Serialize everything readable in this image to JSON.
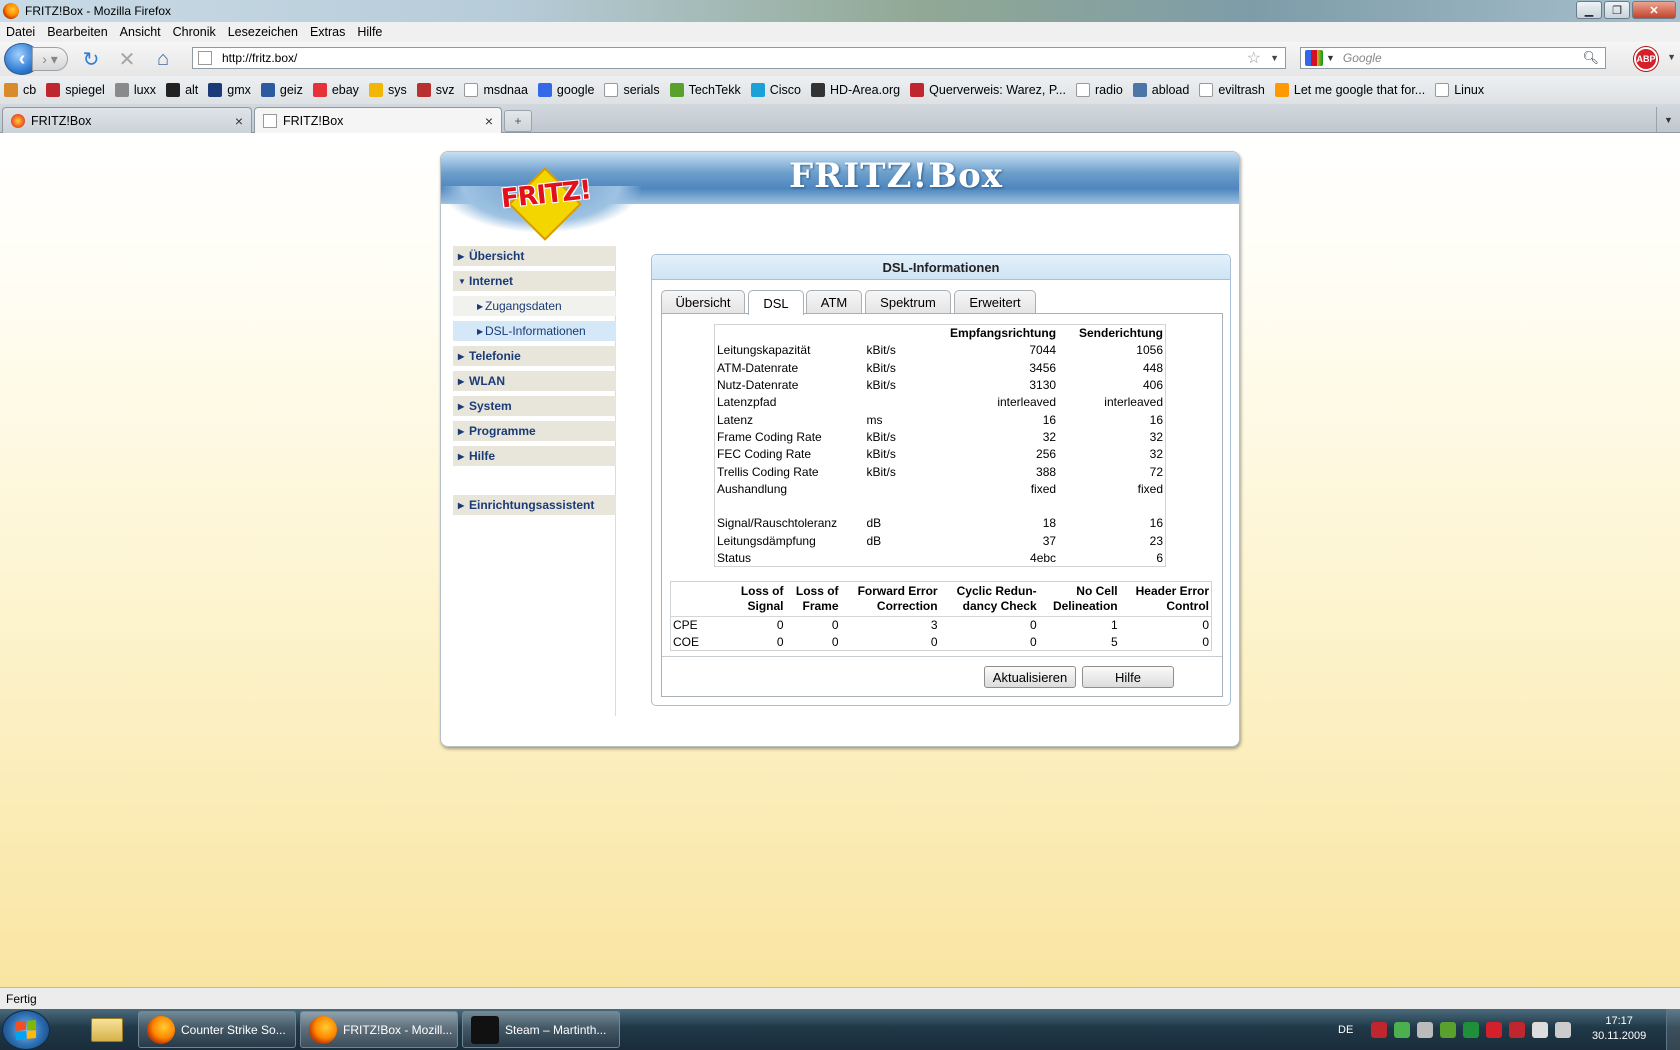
{
  "window": {
    "title": "FRITZ!Box - Mozilla Firefox"
  },
  "menu": [
    "Datei",
    "Bearbeiten",
    "Ansicht",
    "Chronik",
    "Lesezeichen",
    "Extras",
    "Hilfe"
  ],
  "navbar": {
    "url": "http://fritz.box/",
    "search_placeholder": "Google",
    "abp_label": "ABP"
  },
  "bookmarks": [
    {
      "label": "cb",
      "color": "#d98a2b"
    },
    {
      "label": "spiegel",
      "color": "#c0262d"
    },
    {
      "label": "luxx",
      "color": "#8a8a8a"
    },
    {
      "label": "alt",
      "color": "#222222"
    },
    {
      "label": "gmx",
      "color": "#1a3b78"
    },
    {
      "label": "geiz",
      "color": "#2c5aa0"
    },
    {
      "label": "ebay",
      "color": "#e53238"
    },
    {
      "label": "sys",
      "color": "#f2b705"
    },
    {
      "label": "svz",
      "color": "#b8312f"
    },
    {
      "label": "msdnaa",
      "color": "#ffffff"
    },
    {
      "label": "google",
      "color": "#3369e8"
    },
    {
      "label": "serials",
      "color": "#ffffff"
    },
    {
      "label": "TechTekk",
      "color": "#5aa02c"
    },
    {
      "label": "Cisco",
      "color": "#1ba0d7"
    },
    {
      "label": "HD-Area.org",
      "color": "#333333"
    },
    {
      "label": "Querverweis: Warez, P...",
      "color": "#c0262d"
    },
    {
      "label": "radio",
      "color": "#ffffff"
    },
    {
      "label": "abload",
      "color": "#4a76a8"
    },
    {
      "label": "eviltrash",
      "color": "#ffffff"
    },
    {
      "label": "Let me google that for...",
      "color": "#ff9900"
    },
    {
      "label": "Linux",
      "color": "#ffffff"
    }
  ],
  "tabs": [
    {
      "label": "FRITZ!Box"
    },
    {
      "label": "FRITZ!Box"
    }
  ],
  "fritz": {
    "brand": "FRITZ!Box",
    "logo": "FRITZ!",
    "sidebar": {
      "ubersicht": "Übersicht",
      "internet": "Internet",
      "zugangsdaten": "Zugangsdaten",
      "dsl_info": "DSL-Informationen",
      "telefonie": "Telefonie",
      "wlan": "WLAN",
      "system": "System",
      "programme": "Programme",
      "hilfe": "Hilfe",
      "assistent": "Einrichtungsassistent"
    },
    "panel_title": "DSL-Informationen",
    "panel_tabs": [
      "Übersicht",
      "DSL",
      "ATM",
      "Spektrum",
      "Erweitert"
    ],
    "dsl_header": {
      "empfang": "Empfangsrichtung",
      "sende": "Senderichtung"
    },
    "dsl_rows": [
      {
        "label": "Leitungskapazität",
        "unit": "kBit/s",
        "rx": "7044",
        "tx": "1056"
      },
      {
        "label": "ATM-Datenrate",
        "unit": "kBit/s",
        "rx": "3456",
        "tx": "448"
      },
      {
        "label": "Nutz-Datenrate",
        "unit": "kBit/s",
        "rx": "3130",
        "tx": "406"
      },
      {
        "label": "Latenzpfad",
        "unit": "",
        "rx": "interleaved",
        "tx": "interleaved"
      },
      {
        "label": "Latenz",
        "unit": "ms",
        "rx": "16",
        "tx": "16"
      },
      {
        "label": "Frame Coding Rate",
        "unit": "kBit/s",
        "rx": "32",
        "tx": "32"
      },
      {
        "label": "FEC Coding Rate",
        "unit": "kBit/s",
        "rx": "256",
        "tx": "32"
      },
      {
        "label": "Trellis Coding Rate",
        "unit": "kBit/s",
        "rx": "388",
        "tx": "72"
      },
      {
        "label": "Aushandlung",
        "unit": "",
        "rx": "fixed",
        "tx": "fixed"
      },
      {
        "label": "",
        "unit": "",
        "rx": "",
        "tx": ""
      },
      {
        "label": "Signal/Rauschtoleranz",
        "unit": "dB",
        "rx": "18",
        "tx": "16"
      },
      {
        "label": "Leitungsdämpfung",
        "unit": "dB",
        "rx": "37",
        "tx": "23"
      },
      {
        "label": "Status",
        "unit": "",
        "rx": "4ebc",
        "tx": "6"
      }
    ],
    "err_headers": [
      {
        "l1": "Loss of",
        "l2": "Signal"
      },
      {
        "l1": "Loss of",
        "l2": "Frame"
      },
      {
        "l1": "Forward Error",
        "l2": "Correction"
      },
      {
        "l1": "Cyclic Redun-",
        "l2": "dancy Check"
      },
      {
        "l1": "No Cell",
        "l2": "Delineation"
      },
      {
        "l1": "Header Error",
        "l2": "Control"
      }
    ],
    "err_rows": [
      {
        "label": "CPE",
        "values": [
          "0",
          "0",
          "3",
          "0",
          "1",
          "0"
        ]
      },
      {
        "label": "COE",
        "values": [
          "0",
          "0",
          "0",
          "0",
          "5",
          "0"
        ]
      }
    ],
    "buttons": {
      "refresh": "Aktualisieren",
      "help": "Hilfe"
    }
  },
  "status": "Fertig",
  "taskbar": {
    "items": [
      "Counter Strike So...",
      "FRITZ!Box - Mozill...",
      "Steam – Martinth..."
    ],
    "lang": "DE",
    "time": "17:17",
    "date": "30.11.2009"
  },
  "colors": {
    "accent_blue": "#1a3b78",
    "fritz_red": "#e0111b",
    "fritz_yellow": "#f3d600"
  }
}
